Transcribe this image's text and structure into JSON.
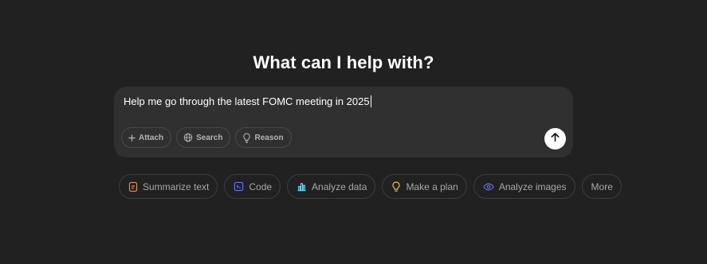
{
  "heading": "What can I help with?",
  "composer": {
    "prompt_text": "Help me go through the latest FOMC meeting in 2025",
    "tools": [
      {
        "label": "Attach",
        "icon": "plus-icon"
      },
      {
        "label": "Search",
        "icon": "globe-icon"
      },
      {
        "label": "Reason",
        "icon": "lightbulb-icon"
      }
    ],
    "send_icon": "arrow-up-icon"
  },
  "suggestions": [
    {
      "label": "Summarize text",
      "icon": "document-icon",
      "color": "#e2884d"
    },
    {
      "label": "Code",
      "icon": "code-icon",
      "color": "#6c71ff"
    },
    {
      "label": "Analyze data",
      "icon": "bar-chart-icon",
      "color": "#76d0eb"
    },
    {
      "label": "Make a plan",
      "icon": "lightbulb-icon",
      "color": "#e2c541"
    },
    {
      "label": "Analyze images",
      "icon": "eye-icon",
      "color": "#6c71ff"
    },
    {
      "label": "More",
      "icon": "",
      "color": ""
    }
  ]
}
